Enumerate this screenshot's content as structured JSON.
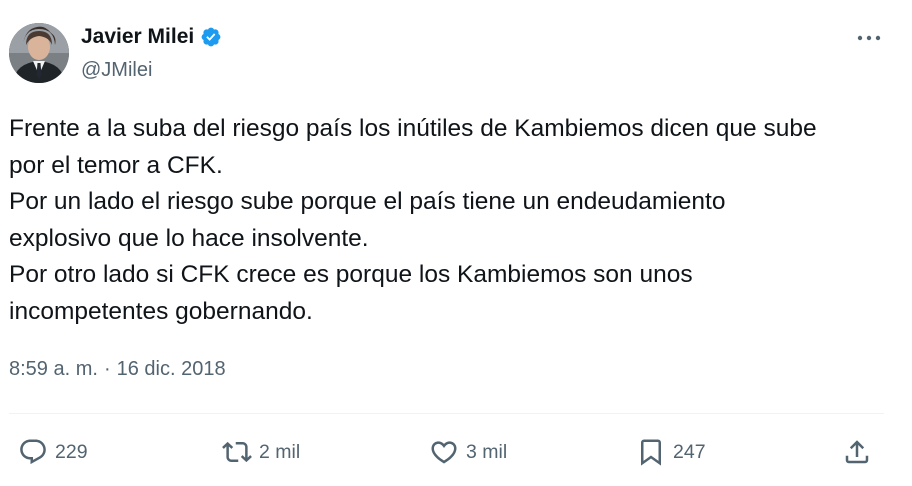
{
  "author": {
    "name": "Javier Milei",
    "handle": "@JMilei",
    "verified": true
  },
  "tweet": {
    "lines": [
      "Frente a la suba del riesgo país los inútiles de Kambiemos dicen que sube",
      "por el temor a CFK.",
      "Por un lado el riesgo sube porque el país tiene un endeudamiento",
      "explosivo que lo hace insolvente.",
      "Por otro lado si CFK crece es porque los Kambiemos son unos",
      "incompetentes gobernando."
    ],
    "time": "8:59 a. m.",
    "separator": "·",
    "date": "16 dic. 2018"
  },
  "actions": {
    "replies": "229",
    "retweets": "2 mil",
    "likes": "3 mil",
    "bookmarks": "247"
  },
  "icons": {
    "verified": "verified-badge-icon",
    "more": "more-options-icon",
    "reply": "reply-icon",
    "retweet": "retweet-icon",
    "like": "like-icon",
    "bookmark": "bookmark-icon",
    "share": "share-icon"
  },
  "colors": {
    "verified_blue": "#1d9bf0",
    "text_primary": "#0f1419",
    "text_secondary": "#536471"
  }
}
